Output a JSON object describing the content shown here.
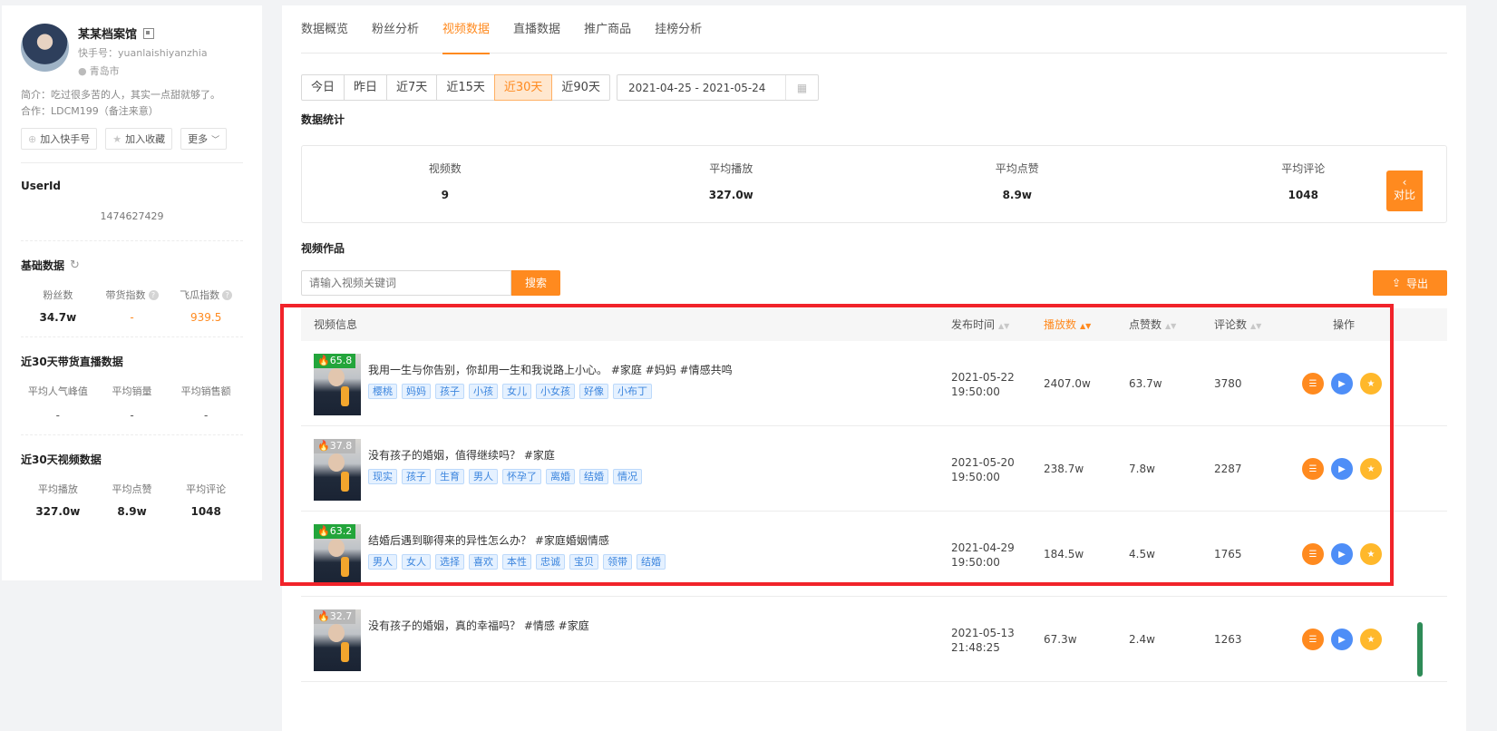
{
  "profile": {
    "name": "某某档案馆",
    "kuaishou_id": "快手号：yuanlaishiyanzhia",
    "city": "青岛市",
    "bio_line1": "简介：吃过很多苦的人，其实一点甜就够了。",
    "bio_line2": "合作：LDCM199（备注来意）",
    "btn_add": "加入快手号",
    "btn_fav": "加入收藏",
    "btn_more": "更多"
  },
  "userid": {
    "label": "UserId",
    "value": "1474627429"
  },
  "basic": {
    "title": "基础数据",
    "stats": [
      {
        "label": "粉丝数",
        "value": "34.7w"
      },
      {
        "label": "带货指数",
        "value": "-"
      },
      {
        "label": "飞瓜指数",
        "value": "939.5"
      }
    ]
  },
  "live30": {
    "title": "近30天带货直播数据",
    "stats": [
      {
        "label": "平均人气峰值",
        "value": "-"
      },
      {
        "label": "平均销量",
        "value": "-"
      },
      {
        "label": "平均销售额",
        "value": "-"
      }
    ]
  },
  "video30": {
    "title": "近30天视频数据",
    "stats": [
      {
        "label": "平均播放",
        "value": "327.0w"
      },
      {
        "label": "平均点赞",
        "value": "8.9w"
      },
      {
        "label": "平均评论",
        "value": "1048"
      }
    ]
  },
  "tabs": [
    "数据概览",
    "粉丝分析",
    "视频数据",
    "直播数据",
    "推广商品",
    "挂榜分析"
  ],
  "active_tab": "视频数据",
  "ranges": [
    "今日",
    "昨日",
    "近7天",
    "近15天",
    "近30天",
    "近90天"
  ],
  "active_range": "近30天",
  "date_range": "2021-04-25  -  2021-05-24",
  "stats_title": "数据统计",
  "summary": [
    {
      "label": "视频数",
      "value": "9"
    },
    {
      "label": "平均播放",
      "value": "327.0w"
    },
    {
      "label": "平均点赞",
      "value": "8.9w"
    },
    {
      "label": "平均评论",
      "value": "1048"
    }
  ],
  "works_title": "视频作品",
  "search": {
    "placeholder": "请输入视频关键词",
    "button": "搜索"
  },
  "export_label": "导出",
  "table": {
    "headers": {
      "info": "视频信息",
      "time": "发布时间",
      "play": "播放数",
      "like": "点赞数",
      "comment": "评论数",
      "ops": "操作"
    },
    "rows": [
      {
        "score": "65.8",
        "score_color": "green",
        "title": "我用一生与你告别，你却用一生和我说路上小心。 #家庭 #妈妈 #情感共鸣",
        "tags": [
          "樱桃",
          "妈妈",
          "孩子",
          "小孩",
          "女儿",
          "小女孩",
          "好像",
          "小布丁"
        ],
        "date": "2021-05-22",
        "time": "19:50:00",
        "play": "2407.0w",
        "like": "63.7w",
        "comment": "3780"
      },
      {
        "score": "37.8",
        "score_color": "gray",
        "title": "没有孩子的婚姻，值得继续吗？  #家庭",
        "tags": [
          "现实",
          "孩子",
          "生育",
          "男人",
          "怀孕了",
          "离婚",
          "结婚",
          "情况"
        ],
        "date": "2021-05-20",
        "time": "19:50:00",
        "play": "238.7w",
        "like": "7.8w",
        "comment": "2287"
      },
      {
        "score": "63.2",
        "score_color": "green",
        "title": "结婚后遇到聊得来的异性怎么办？  #家庭婚姻情感",
        "tags": [
          "男人",
          "女人",
          "选择",
          "喜欢",
          "本性",
          "忠诚",
          "宝贝",
          "领带",
          "结婚"
        ],
        "date": "2021-04-29",
        "time": "19:50:00",
        "play": "184.5w",
        "like": "4.5w",
        "comment": "1765"
      },
      {
        "score": "32.7",
        "score_color": "gray",
        "title": "没有孩子的婚姻，真的幸福吗？ #情感 #家庭",
        "tags": [],
        "date": "2021-05-13",
        "time": "21:48:25",
        "play": "67.3w",
        "like": "2.4w",
        "comment": "1263"
      }
    ]
  },
  "compare_label": "对比",
  "colors": {
    "accent": "#ff8a1f",
    "highlight": "#f1232a",
    "tag_blue": "#3d86de"
  }
}
